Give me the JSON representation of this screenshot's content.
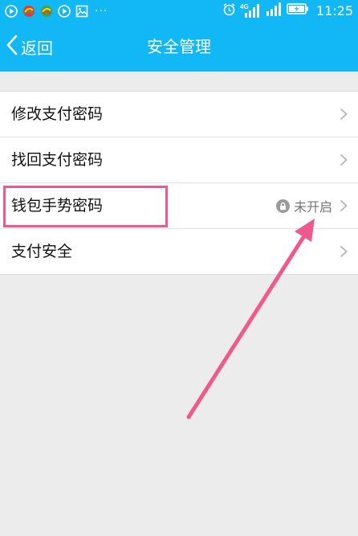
{
  "status_bar": {
    "time": "11:25",
    "dots": "···",
    "network": "4G",
    "colors": {
      "background": "#12b7f5",
      "text": "#ffffff"
    },
    "icons": [
      "play-icon",
      "app-icon",
      "app-icon",
      "play-icon",
      "image-icon",
      "alarm-icon",
      "signal-icon",
      "signal-icon",
      "battery-charging-icon"
    ]
  },
  "header": {
    "back_label": "返回",
    "title": "安全管理"
  },
  "menu": {
    "items": [
      {
        "label": "修改支付密码"
      },
      {
        "label": "找回支付密码"
      },
      {
        "label": "钱包手势密码",
        "status": "未开启",
        "status_icon": "lock-icon"
      },
      {
        "label": "支付安全"
      }
    ]
  },
  "annotation": {
    "highlight_color": "#ef5a8c",
    "arrow_color": "#ef5a8c"
  }
}
